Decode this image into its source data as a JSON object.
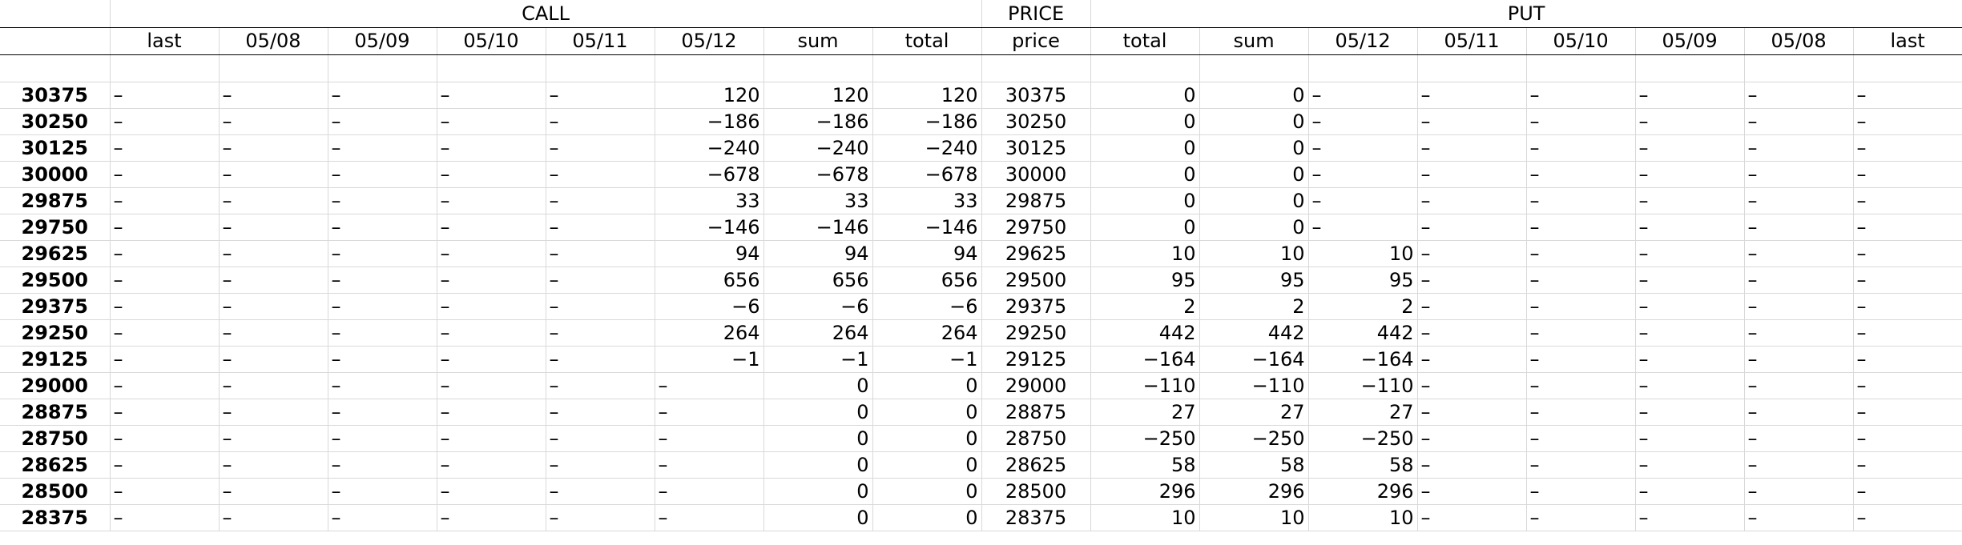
{
  "groups": {
    "call": "CALL",
    "price": "PRICE",
    "put": "PUT"
  },
  "call_columns": [
    "last",
    "05/08",
    "05/09",
    "05/10",
    "05/11",
    "05/12",
    "sum",
    "total"
  ],
  "price_column": "price",
  "put_columns": [
    "total",
    "sum",
    "05/12",
    "05/11",
    "05/10",
    "05/09",
    "05/08",
    "last"
  ],
  "rows": [
    {
      "strike": "30375",
      "call": [
        "–",
        "–",
        "–",
        "–",
        "–",
        "120",
        "120",
        "120"
      ],
      "price": "30375",
      "put": [
        "0",
        "0",
        "–",
        "–",
        "–",
        "–",
        "–",
        "–"
      ]
    },
    {
      "strike": "30250",
      "call": [
        "–",
        "–",
        "–",
        "–",
        "–",
        "−186",
        "−186",
        "−186"
      ],
      "price": "30250",
      "put": [
        "0",
        "0",
        "–",
        "–",
        "–",
        "–",
        "–",
        "–"
      ]
    },
    {
      "strike": "30125",
      "call": [
        "–",
        "–",
        "–",
        "–",
        "–",
        "−240",
        "−240",
        "−240"
      ],
      "price": "30125",
      "put": [
        "0",
        "0",
        "–",
        "–",
        "–",
        "–",
        "–",
        "–"
      ]
    },
    {
      "strike": "30000",
      "call": [
        "–",
        "–",
        "–",
        "–",
        "–",
        "−678",
        "−678",
        "−678"
      ],
      "price": "30000",
      "put": [
        "0",
        "0",
        "–",
        "–",
        "–",
        "–",
        "–",
        "–"
      ]
    },
    {
      "strike": "29875",
      "call": [
        "–",
        "–",
        "–",
        "–",
        "–",
        "33",
        "33",
        "33"
      ],
      "price": "29875",
      "put": [
        "0",
        "0",
        "–",
        "–",
        "–",
        "–",
        "–",
        "–"
      ]
    },
    {
      "strike": "29750",
      "call": [
        "–",
        "–",
        "–",
        "–",
        "–",
        "−146",
        "−146",
        "−146"
      ],
      "price": "29750",
      "put": [
        "0",
        "0",
        "–",
        "–",
        "–",
        "–",
        "–",
        "–"
      ]
    },
    {
      "strike": "29625",
      "call": [
        "–",
        "–",
        "–",
        "–",
        "–",
        "94",
        "94",
        "94"
      ],
      "price": "29625",
      "put": [
        "10",
        "10",
        "10",
        "–",
        "–",
        "–",
        "–",
        "–"
      ]
    },
    {
      "strike": "29500",
      "call": [
        "–",
        "–",
        "–",
        "–",
        "–",
        "656",
        "656",
        "656"
      ],
      "price": "29500",
      "put": [
        "95",
        "95",
        "95",
        "–",
        "–",
        "–",
        "–",
        "–"
      ]
    },
    {
      "strike": "29375",
      "call": [
        "–",
        "–",
        "–",
        "–",
        "–",
        "−6",
        "−6",
        "−6"
      ],
      "price": "29375",
      "put": [
        "2",
        "2",
        "2",
        "–",
        "–",
        "–",
        "–",
        "–"
      ]
    },
    {
      "strike": "29250",
      "call": [
        "–",
        "–",
        "–",
        "–",
        "–",
        "264",
        "264",
        "264"
      ],
      "price": "29250",
      "put": [
        "442",
        "442",
        "442",
        "–",
        "–",
        "–",
        "–",
        "–"
      ]
    },
    {
      "strike": "29125",
      "call": [
        "–",
        "–",
        "–",
        "–",
        "–",
        "−1",
        "−1",
        "−1"
      ],
      "price": "29125",
      "put": [
        "−164",
        "−164",
        "−164",
        "–",
        "–",
        "–",
        "–",
        "–"
      ]
    },
    {
      "strike": "29000",
      "call": [
        "–",
        "–",
        "–",
        "–",
        "–",
        "–",
        "0",
        "0"
      ],
      "price": "29000",
      "put": [
        "−110",
        "−110",
        "−110",
        "–",
        "–",
        "–",
        "–",
        "–"
      ]
    },
    {
      "strike": "28875",
      "call": [
        "–",
        "–",
        "–",
        "–",
        "–",
        "–",
        "0",
        "0"
      ],
      "price": "28875",
      "put": [
        "27",
        "27",
        "27",
        "–",
        "–",
        "–",
        "–",
        "–"
      ]
    },
    {
      "strike": "28750",
      "call": [
        "–",
        "–",
        "–",
        "–",
        "–",
        "–",
        "0",
        "0"
      ],
      "price": "28750",
      "put": [
        "−250",
        "−250",
        "−250",
        "–",
        "–",
        "–",
        "–",
        "–"
      ]
    },
    {
      "strike": "28625",
      "call": [
        "–",
        "–",
        "–",
        "–",
        "–",
        "–",
        "0",
        "0"
      ],
      "price": "28625",
      "put": [
        "58",
        "58",
        "58",
        "–",
        "–",
        "–",
        "–",
        "–"
      ]
    },
    {
      "strike": "28500",
      "call": [
        "–",
        "–",
        "–",
        "–",
        "–",
        "–",
        "0",
        "0"
      ],
      "price": "28500",
      "put": [
        "296",
        "296",
        "296",
        "–",
        "–",
        "–",
        "–",
        "–"
      ]
    },
    {
      "strike": "28375",
      "call": [
        "–",
        "–",
        "–",
        "–",
        "–",
        "–",
        "0",
        "0"
      ],
      "price": "28375",
      "put": [
        "10",
        "10",
        "10",
        "–",
        "–",
        "–",
        "–",
        "–"
      ]
    }
  ]
}
